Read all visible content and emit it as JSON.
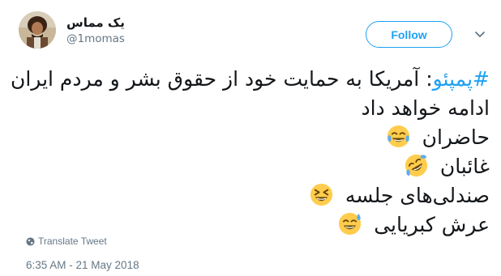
{
  "author": {
    "name": "یک مماس",
    "handle": "@1momas"
  },
  "follow_label": "Follow",
  "tweet": {
    "lines": [
      {
        "hashtag": "#پمپئو",
        "text": ": آمریکا به حمایت خود از حقوق بشر و مردم ایران",
        "emoji": ""
      },
      {
        "hashtag": "",
        "text": "ادامه خواهد داد",
        "emoji": ""
      },
      {
        "hashtag": "",
        "text": "حاضران",
        "emoji": "tears-of-joy-icon"
      },
      {
        "hashtag": "",
        "text": "غائبان",
        "emoji": "rolling-laughing-icon"
      },
      {
        "hashtag": "",
        "text": "صندلی‌های جلسه",
        "emoji": "squinting-grin-icon"
      },
      {
        "hashtag": "",
        "text": "عرش کبریایی",
        "emoji": "grin-sweat-icon"
      }
    ]
  },
  "translate_label": "Translate Tweet",
  "timestamp": "6:35 AM - 21 May 2018",
  "colors": {
    "accent": "#1da1f2",
    "secondary_text": "#657786",
    "primary_text": "#14171a"
  }
}
